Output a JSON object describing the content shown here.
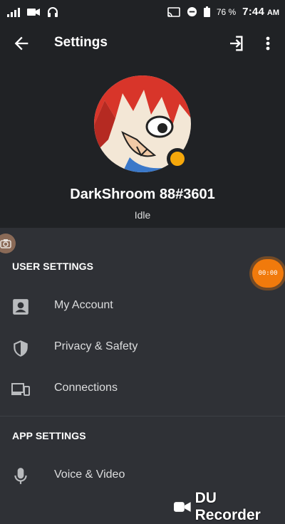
{
  "status_bar": {
    "battery_percent": "76 %",
    "time": "7:44",
    "time_suffix": "AM",
    "icons": [
      "signal-icon",
      "video-icon",
      "headset-icon",
      "cast-icon",
      "do-not-disturb-icon",
      "battery-icon"
    ]
  },
  "app_bar": {
    "title": "Settings",
    "icons": [
      "back-arrow-icon",
      "logout-icon",
      "overflow-menu-icon"
    ]
  },
  "profile": {
    "username": "DarkShroom 88#3601",
    "status": "Idle",
    "status_color": "#f6a80b"
  },
  "sections": {
    "user_settings": {
      "header": "USER SETTINGS",
      "items": [
        {
          "label": "My Account",
          "icon": "account-icon"
        },
        {
          "label": "Privacy & Safety",
          "icon": "shield-icon"
        },
        {
          "label": "Connections",
          "icon": "devices-icon"
        }
      ]
    },
    "app_settings": {
      "header": "APP SETTINGS",
      "items": [
        {
          "label": "Voice & Video",
          "icon": "microphone-icon"
        }
      ]
    }
  },
  "overlay": {
    "record_timer": "00:00",
    "recorder_brand": "DU Recorder",
    "accent": "#f17a0c"
  }
}
